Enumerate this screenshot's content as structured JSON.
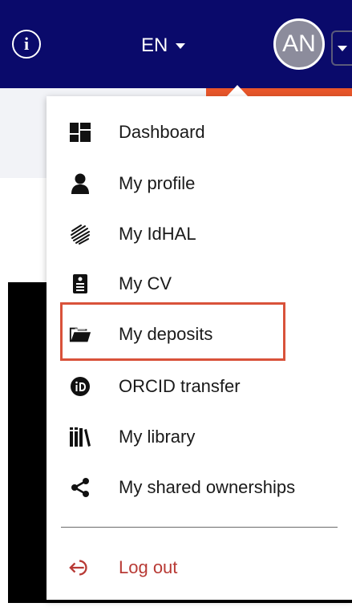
{
  "header": {
    "language": "EN",
    "avatar_initials": "AN",
    "info_icon": "info-icon"
  },
  "menu": {
    "items": [
      {
        "label": "Dashboard",
        "icon": "dashboard-icon"
      },
      {
        "label": "My profile",
        "icon": "user-icon"
      },
      {
        "label": "My IdHAL",
        "icon": "fingerprint-icon"
      },
      {
        "label": "My CV",
        "icon": "cv-icon"
      },
      {
        "label": "My deposits",
        "icon": "folder-open-icon"
      },
      {
        "label": "ORCID transfer",
        "icon": "orcid-icon"
      },
      {
        "label": "My library",
        "icon": "library-icon"
      },
      {
        "label": "My shared ownerships",
        "icon": "share-icon"
      }
    ],
    "logout_label": "Log out",
    "logout_icon": "logout-icon"
  },
  "colors": {
    "header_bg": "#0a0a6b",
    "accent_orange": "#e8562a",
    "highlight_border": "#d9523a",
    "logout_text": "#b83a35"
  }
}
